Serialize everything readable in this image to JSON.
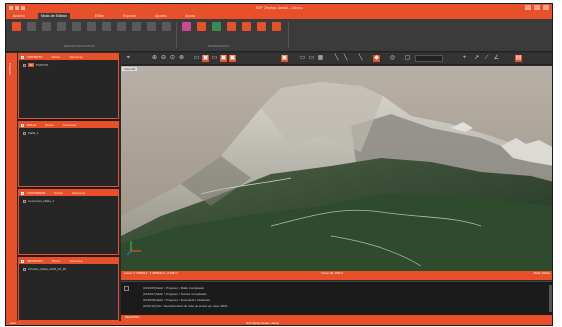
{
  "window": {
    "title": "3DF Zephyr Aerial – Demo"
  },
  "tabs": [
    "Archivo",
    "Modo de Edición",
    "Editar",
    "Exportar",
    "Ajustes",
    "Ayuda"
  ],
  "ribbon": {
    "group_left": "EDICIÓN DE PUNTOS",
    "group_right": "INTERACCIÓN"
  },
  "panels": [
    {
      "header": "CONTEXTO",
      "opt1": "Mostrar",
      "opt2": "Seleccionar",
      "item": "PUNTOS",
      "tag": "3D"
    },
    {
      "header": "MALLA",
      "opt1": "Mostrar",
      "opt2": "Seleccionar",
      "item": "Malla_1"
    },
    {
      "header": "CONTORNOS",
      "opt1": "Mostrar",
      "opt2": "Seleccionar",
      "item": "Contornos_Malla_1"
    },
    {
      "header": "ORTOFOTO",
      "opt1": "Mostrar",
      "opt2": "Seleccionar",
      "item": "Ortofoto_Malla_2018_03_20"
    }
  ],
  "side_strip_label": "Proyecto",
  "viewport": {
    "tab_label": "Vista 3D"
  },
  "view_status": {
    "left": "Cursor: X 370591.3 · Y 4095244.3 · Z 1097.4",
    "center": "Cursor (Z): 1097.4",
    "right": "Modo: Orbitar"
  },
  "log": {
    "lines": [
      "[13:09:05] Mesh  > Progreso  > Malla: Completado",
      "[13:09:07] Mesh  > Progreso  > Textura: Completado",
      "[13:09:08] Mesh  > Progreso  > Exportación: Finalizado",
      "[13:09:10] Info  > Reconstrucción de nube de puntos por vista: 100%"
    ]
  },
  "log_bar_label": "REGISTRO",
  "statusbar": {
    "left": "Listo",
    "center": "3DF Zephyr Aerial – Demo"
  },
  "colors": {
    "accent": "#e8502a",
    "dark_bg": "#2b2b2b",
    "panel_bg": "#262626"
  }
}
